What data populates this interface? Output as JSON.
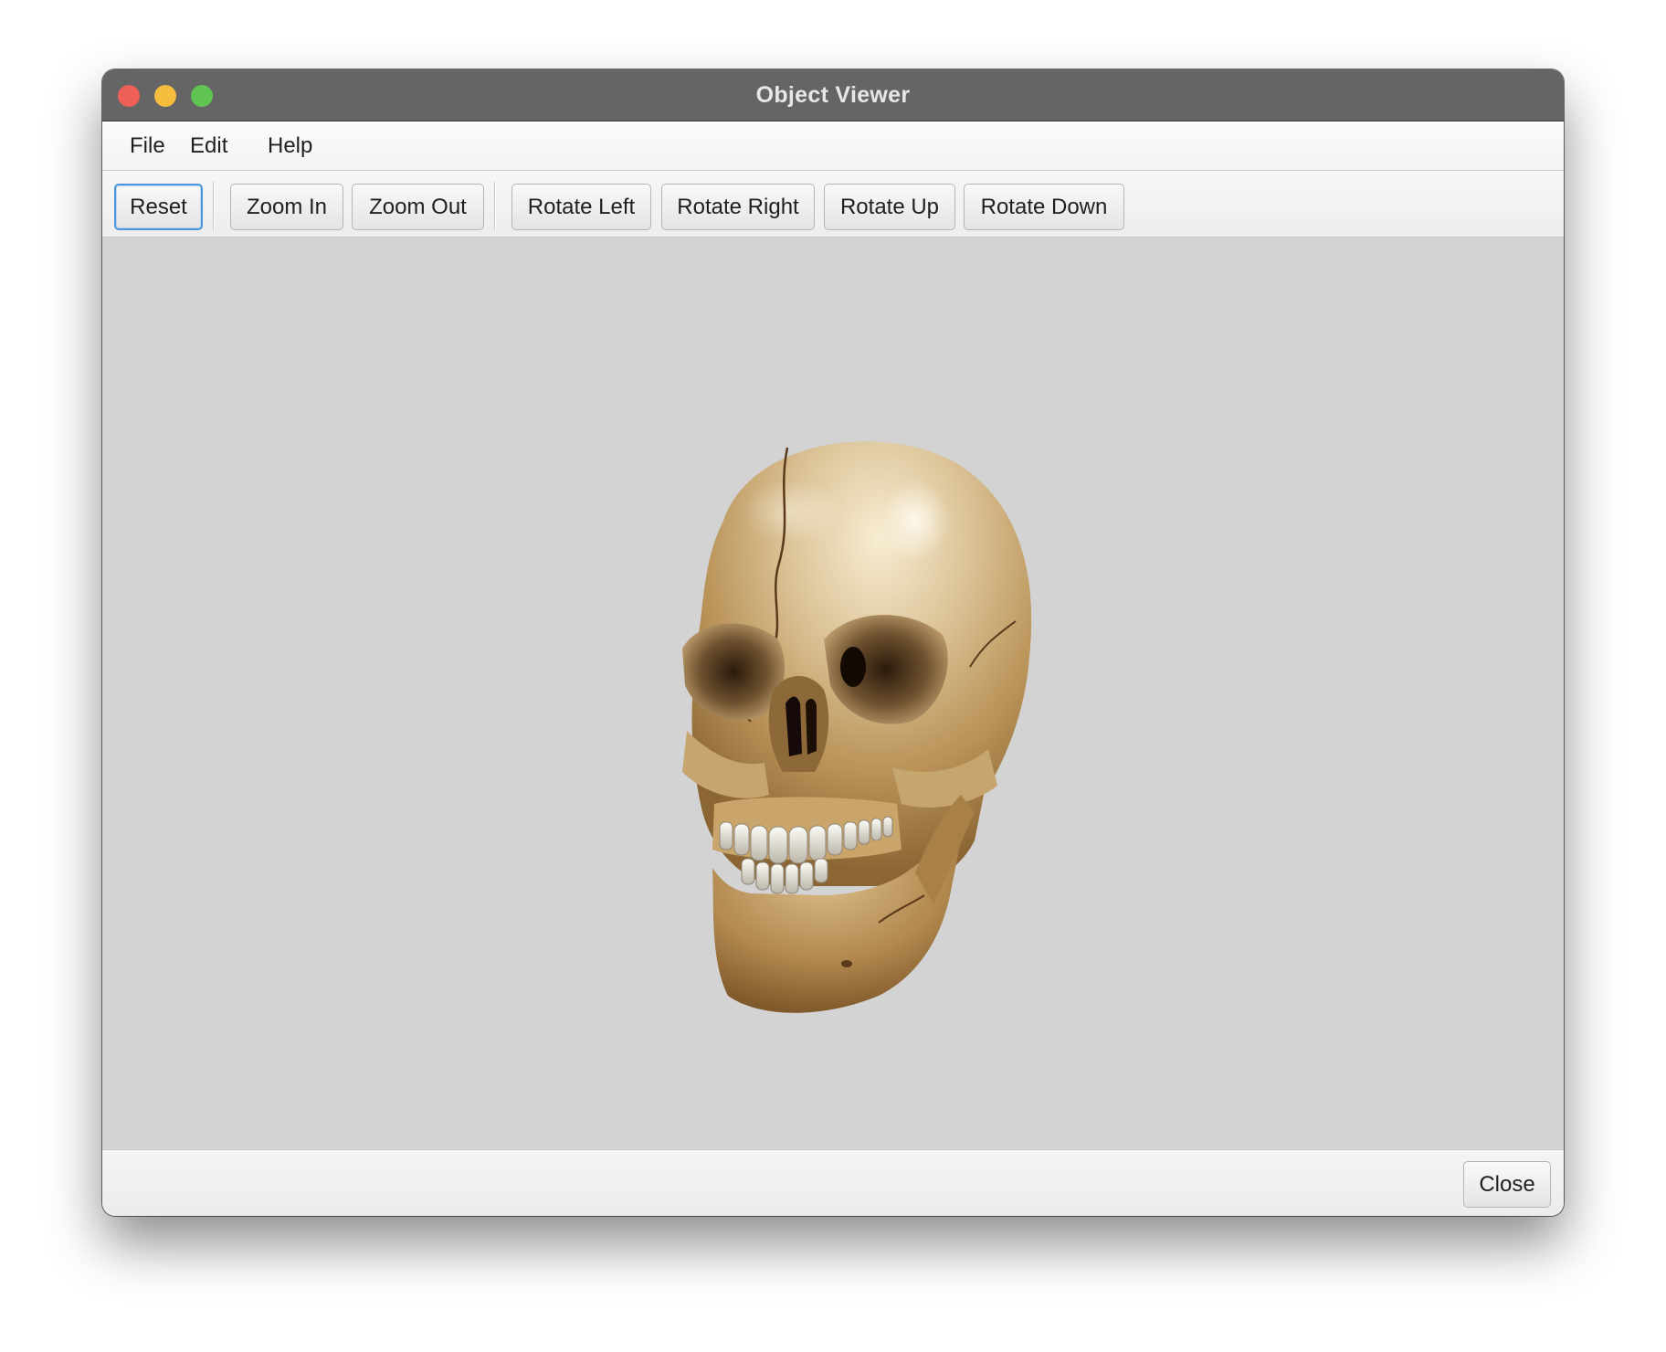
{
  "window": {
    "title": "Object Viewer"
  },
  "menubar": {
    "items": [
      {
        "label": "File"
      },
      {
        "label": "Edit"
      },
      {
        "label": "Help"
      }
    ]
  },
  "toolbar": {
    "buttons": [
      {
        "label": "Reset",
        "focused": true
      },
      {
        "label": "Zoom In"
      },
      {
        "label": "Zoom Out"
      },
      {
        "label": "Rotate Left"
      },
      {
        "label": "Rotate Right"
      },
      {
        "label": "Rotate Up"
      },
      {
        "label": "Rotate Down"
      }
    ]
  },
  "viewport": {
    "object_icon": "skull-model",
    "background_color": "#d3d3d3"
  },
  "footer": {
    "close_label": "Close"
  },
  "colors": {
    "titlebar": "#656565",
    "focus_ring": "#4d97d9",
    "traffic_close": "#ed5f57",
    "traffic_minimize": "#f4bd3e",
    "traffic_maximize": "#5fc452"
  }
}
